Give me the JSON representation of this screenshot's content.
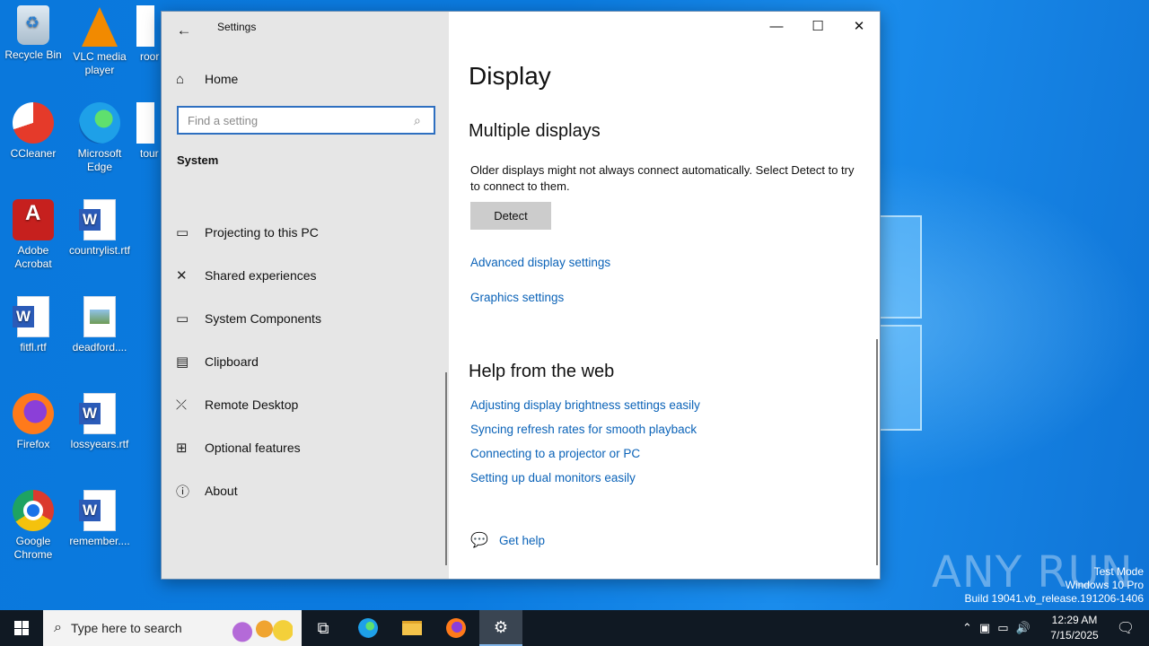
{
  "desktop": {
    "icons": [
      {
        "label": "Recycle Bin",
        "icon": "recycle-bin-icon"
      },
      {
        "label": "VLC media player",
        "icon": "vlc-icon"
      },
      {
        "label": "roor",
        "icon": "document-icon"
      },
      {
        "label": "CCleaner",
        "icon": "ccleaner-icon"
      },
      {
        "label": "Microsoft Edge",
        "icon": "edge-icon"
      },
      {
        "label": "tour",
        "icon": "document-icon"
      },
      {
        "label": "Adobe Acrobat",
        "icon": "acrobat-icon"
      },
      {
        "label": "countrylist.rtf",
        "icon": "word-doc-icon"
      },
      {
        "label": "fitfl.rtf",
        "icon": "word-doc-icon"
      },
      {
        "label": "deadford....",
        "icon": "image-file-icon"
      },
      {
        "label": "Firefox",
        "icon": "firefox-icon"
      },
      {
        "label": "lossyears.rtf",
        "icon": "word-doc-icon"
      },
      {
        "label": "Google Chrome",
        "icon": "chrome-icon"
      },
      {
        "label": "remember....",
        "icon": "word-doc-icon"
      }
    ]
  },
  "window": {
    "title": "Settings",
    "controls": {
      "minimize": "—",
      "maximize": "☐",
      "close": "✕"
    }
  },
  "nav": {
    "home": "Home",
    "search_placeholder": "Find a setting",
    "section": "System",
    "items": [
      {
        "label": "Projecting to this PC",
        "icon": "projector-icon"
      },
      {
        "label": "Shared experiences",
        "icon": "shared-icon"
      },
      {
        "label": "System Components",
        "icon": "components-icon"
      },
      {
        "label": "Clipboard",
        "icon": "clipboard-icon"
      },
      {
        "label": "Remote Desktop",
        "icon": "remote-desktop-icon"
      },
      {
        "label": "Optional features",
        "icon": "optional-features-icon"
      },
      {
        "label": "About",
        "icon": "info-icon"
      }
    ]
  },
  "content": {
    "title": "Display",
    "multiple_displays": {
      "heading": "Multiple displays",
      "description": "Older displays might not always connect automatically. Select Detect to try to connect to them.",
      "detect_label": "Detect"
    },
    "links": [
      "Advanced display settings",
      "Graphics settings"
    ],
    "help": {
      "heading": "Help from the web",
      "links": [
        "Adjusting display brightness settings easily",
        "Syncing refresh rates for smooth playback",
        "Connecting to a projector or PC",
        "Setting up dual monitors easily"
      ],
      "get_help": "Get help"
    }
  },
  "watermark": {
    "brand": "ANY RUN",
    "line1": "Test Mode",
    "line2": "Windows 10 Pro",
    "line3": "Build 19041.vb_release.191206-1406"
  },
  "taskbar": {
    "search_placeholder": "Type here to search",
    "time": "12:29 AM",
    "date": "7/15/2025"
  }
}
